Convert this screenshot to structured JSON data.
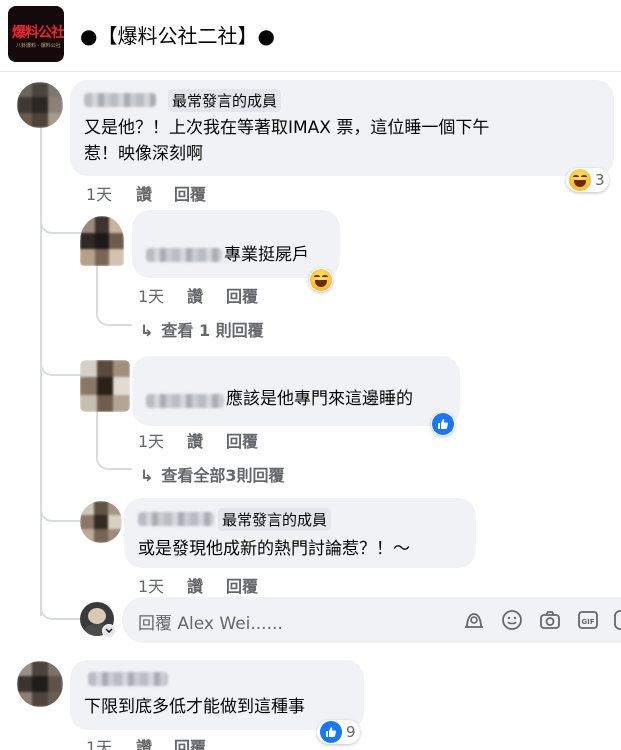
{
  "header": {
    "group_name": "●【爆料公社二社】●",
    "logo_text": "爆料公社",
    "logo_subtext": "八卦爆料 · 爆料公社"
  },
  "comments": [
    {
      "badge": "最常發言的成員",
      "text_line1": "又是他？！上次我在等著取IMAX 票，這位睡一個下午",
      "text_line2": "惹！映像深刻啊",
      "time": "1天",
      "like": "讚",
      "reply": "回覆",
      "reaction": {
        "type": "haha",
        "count": "3"
      }
    },
    {
      "text": "專業挺屍戶",
      "time": "1天",
      "like": "讚",
      "reply": "回覆",
      "reaction": {
        "type": "haha",
        "count": ""
      },
      "view_replies": "查看 1 則回覆"
    },
    {
      "text": "應該是他專門來這邊睡的",
      "time": "1天",
      "like": "讚",
      "reply": "回覆",
      "reaction": {
        "type": "like",
        "count": ""
      },
      "view_replies": "查看全部3則回覆"
    },
    {
      "badge": "最常發言的成員",
      "text": "或是發現他成新的熱門討論惹？！～",
      "time": "1天",
      "like": "讚",
      "reply": "回覆"
    },
    {
      "text": "下限到底多低才能做到這種事",
      "time": "1天",
      "like": "讚",
      "reply": "回覆",
      "reaction": {
        "type": "like",
        "count": "9"
      }
    }
  ],
  "reply_box": {
    "placeholder": "回覆 Alex Wei......",
    "icons": [
      "avatar-sticker-icon",
      "emoji-icon",
      "camera-icon",
      "gif-icon",
      "sticker-icon"
    ]
  },
  "colors": {
    "bubble": "#f0f2f5",
    "meta_text": "#65676b",
    "like_blue": "#1877f2",
    "haha_yellow": "#f7b125",
    "logo_red": "#e8282e"
  }
}
